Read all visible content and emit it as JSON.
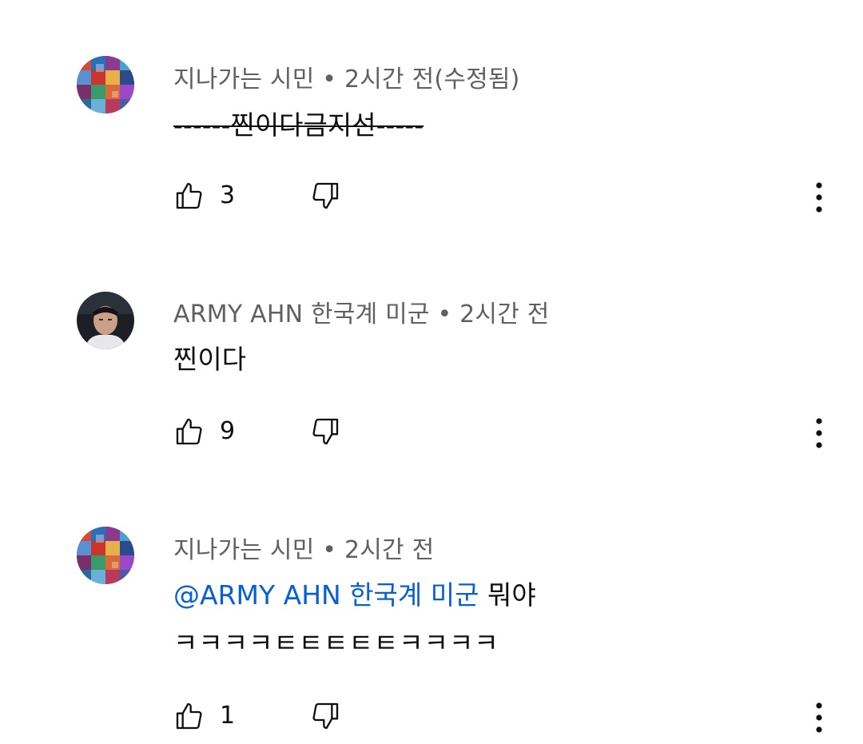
{
  "comments": [
    {
      "author": "지나가는 시민",
      "separator": "•",
      "time": "2시간 전(수정됨)",
      "text_parts": [
        "------",
        "찐이다금지선",
        "-----"
      ],
      "likes": "3",
      "avatar_icon": "mosaic-avatar"
    },
    {
      "author": "ARMY AHN 한국계 미군",
      "separator": "•",
      "time": "2시간 전",
      "text": "찐이다",
      "likes": "9",
      "avatar_icon": "person-photo-avatar"
    },
    {
      "author": "지나가는 시민",
      "separator": "•",
      "time": "2시간 전",
      "mention": "@ARMY AHN 한국계 미군",
      "text_after_mention": "뭐야",
      "text_line2": "ㅋㅋㅋㅋㅌㅌㅌㅌㅌㅋㅋㅋㅋ",
      "likes": "1",
      "avatar_icon": "mosaic-avatar"
    }
  ],
  "icons": {
    "like": "thumbs-up-icon",
    "dislike": "thumbs-down-icon",
    "more": "more-vertical-icon"
  },
  "colors": {
    "meta_text": "#606060",
    "body_text": "#0f0f0f",
    "mention_link": "#065fd4"
  }
}
